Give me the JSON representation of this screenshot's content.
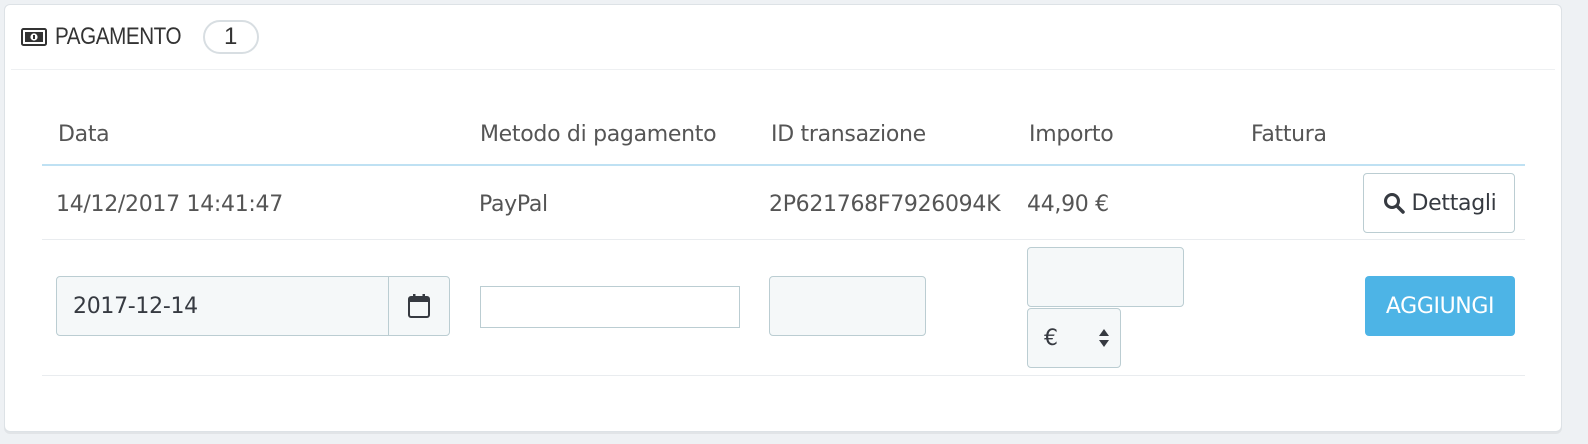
{
  "panel": {
    "title": "PAGAMENTO",
    "count": "1",
    "icon": "money-icon"
  },
  "table": {
    "headers": [
      "Data",
      "Metodo di pagamento",
      "ID transazione",
      "Importo",
      "Fattura"
    ],
    "rows": [
      {
        "date": "14/12/2017 14:41:47",
        "method": "PayPal",
        "transaction_id": "2P621768F7926094K",
        "amount": "44,90 €",
        "invoice": "",
        "details_label": "Dettagli"
      }
    ]
  },
  "form": {
    "date_value": "2017-12-14",
    "method_value": "",
    "transaction_value": "",
    "amount_value": "",
    "currency": "€",
    "add_label": "AGGIUNGI"
  },
  "colors": {
    "accent": "#4db4e6",
    "header_rule": "#bfe1f3"
  }
}
